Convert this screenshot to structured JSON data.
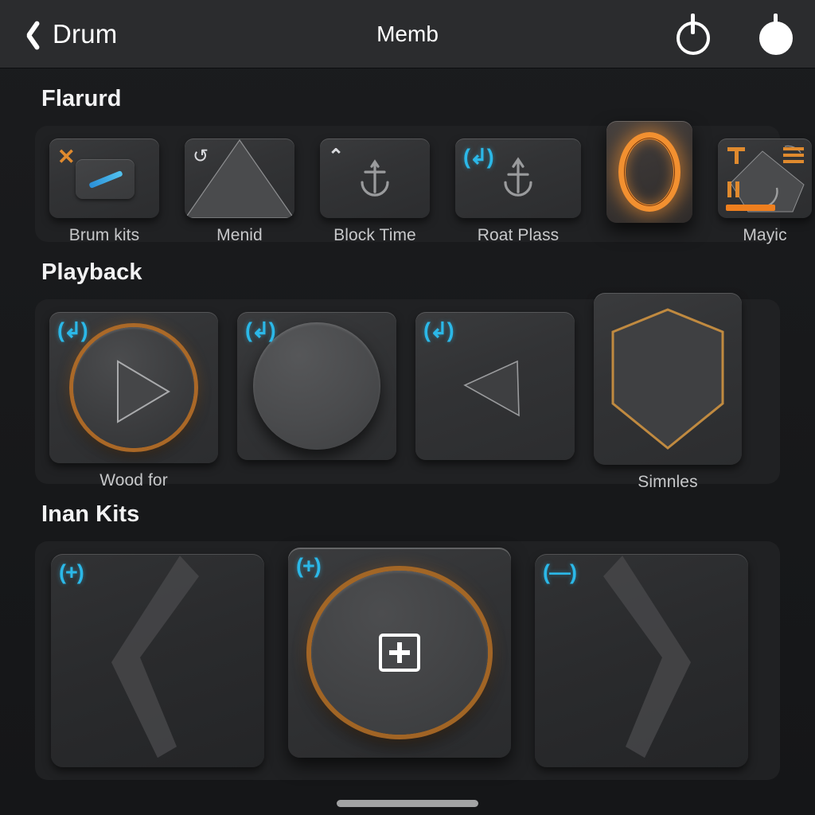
{
  "header": {
    "back_label": "Drum",
    "title": "Memb",
    "back_icon": "chevron-left-icon",
    "action_icons": [
      "power-outline-icon",
      "power-filled-icon"
    ]
  },
  "sections": [
    {
      "title": "Flarurd",
      "items": [
        {
          "label": "Brum kits",
          "badge": "✕",
          "badge_kind": "x",
          "icon": "pen-in-rect-icon"
        },
        {
          "label": "Menid",
          "badge": "↺",
          "badge_kind": "curl",
          "icon": "triangle-icon"
        },
        {
          "label": "Block Time",
          "badge": "⌃",
          "badge_kind": "chev",
          "icon": "anchor-icon"
        },
        {
          "label": "Roat Plass",
          "badge": "(↲)",
          "badge_kind": "cyan",
          "icon": "anchor-up-icon"
        },
        {
          "label": "",
          "badge": "",
          "badge_kind": "none",
          "icon": "glow-ring-icon",
          "selected": true
        },
        {
          "label": "Mayic",
          "badge": "",
          "badge_kind": "none",
          "icon": "media-card-icon"
        }
      ]
    },
    {
      "title": "Playback",
      "items": [
        {
          "label": "Wood for",
          "badge": "(↲)",
          "badge_kind": "cyan",
          "icon": "play-knob-icon"
        },
        {
          "label": "",
          "badge": "(↲)",
          "badge_kind": "cyan",
          "icon": "plain-knob-icon"
        },
        {
          "label": "",
          "badge": "(↲)",
          "badge_kind": "cyan",
          "icon": "triangle-left-icon"
        },
        {
          "label": "Simnles",
          "badge": "",
          "badge_kind": "none",
          "icon": "shield-icon"
        }
      ]
    },
    {
      "title": "Inan Kits",
      "items": [
        {
          "label": "",
          "badge": "(+)",
          "badge_kind": "cyan",
          "icon": "chevron-left-bolt-icon"
        },
        {
          "label": "",
          "badge": "(+)",
          "badge_kind": "cyan",
          "icon": "add-knob-icon",
          "selected": true
        },
        {
          "label": "",
          "badge": "(—)",
          "badge_kind": "cyan",
          "icon": "chevron-right-bolt-icon"
        }
      ]
    }
  ],
  "colors": {
    "accent_orange": "#f29030",
    "accent_cyan": "#2bb8e8",
    "background": "#1a1b1d",
    "tray": "#202123",
    "text_primary": "#f2f2f3",
    "text_secondary": "#c7c8ca"
  },
  "home_indicator": "home-bar"
}
